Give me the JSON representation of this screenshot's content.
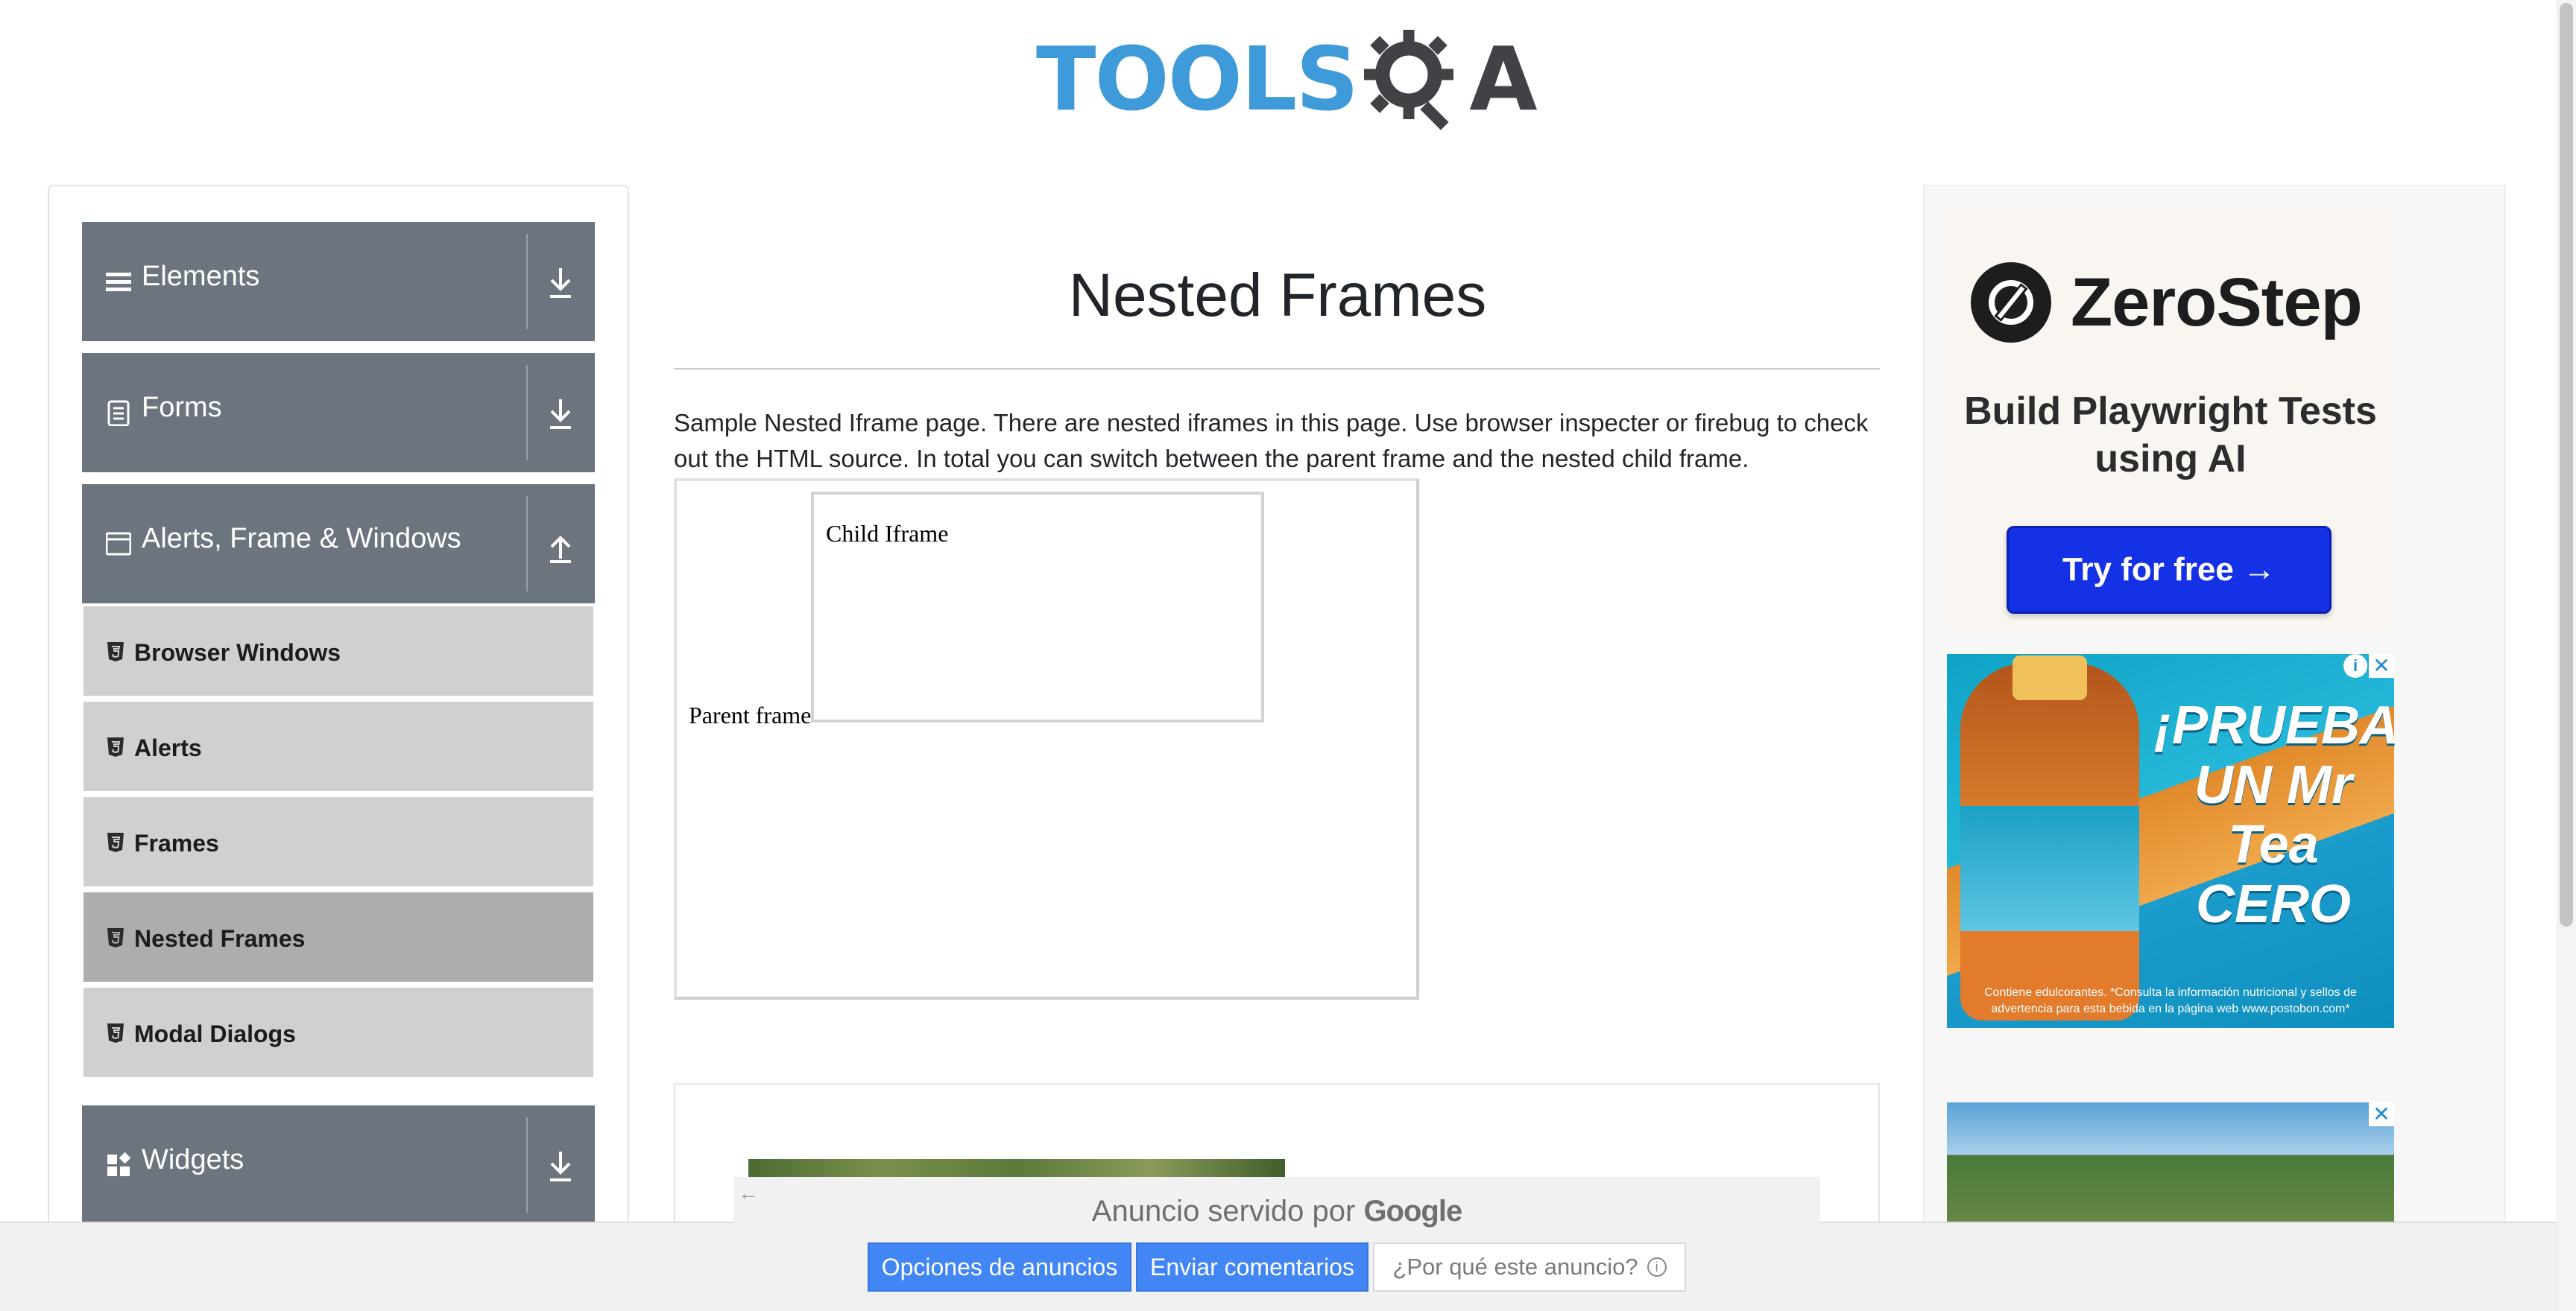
{
  "header": {
    "logo_text_left": "TOOLS",
    "logo_text_right": "A",
    "logo_icon": "gear-magnifier-icon"
  },
  "sidebar": {
    "groups": [
      {
        "label": "Elements",
        "icon": "hamburger-icon",
        "toggle_icon": "expand-down-icon"
      },
      {
        "label": "Forms",
        "icon": "document-icon",
        "toggle_icon": "expand-down-icon"
      },
      {
        "label": "Alerts, Frame & Windows",
        "icon": "window-icon",
        "toggle_icon": "collapse-up-icon"
      },
      {
        "label": "Widgets",
        "icon": "widgets-icon",
        "toggle_icon": "expand-down-icon"
      }
    ],
    "items": [
      {
        "label": "Browser Windows",
        "icon": "html5-icon",
        "active": false
      },
      {
        "label": "Alerts",
        "icon": "html5-icon",
        "active": false
      },
      {
        "label": "Frames",
        "icon": "html5-icon",
        "active": false
      },
      {
        "label": "Nested Frames",
        "icon": "html5-icon",
        "active": true
      },
      {
        "label": "Modal Dialogs",
        "icon": "html5-icon",
        "active": false
      }
    ]
  },
  "main": {
    "title": "Nested Frames",
    "description": "Sample Nested Iframe page. There are nested iframes in this page. Use browser inspecter or firebug to check out the HTML source. In total you can switch between the parent frame and the nested child frame.",
    "parent_frame_text": "Parent frame",
    "child_frame_text": "Child Iframe"
  },
  "ads": {
    "zerostep": {
      "brand": "ZeroStep",
      "headline": "Build Playwright Tests using AI",
      "cta": "Try for free →"
    },
    "tea": {
      "headline": "¡PRUEBA UN Mr Tea CERO",
      "footer": "Contiene edulcorantes. *Consulta la información nutricional y sellos de advertencia para esta bebida en la página web www.postobon.com*"
    }
  },
  "anchor_ad": {
    "served_by": "Anuncio servido por",
    "served_brand": "Google",
    "options_label": "Opciones de anuncios",
    "feedback_label": "Enviar comentarios",
    "why_label": "¿Por qué este anuncio?"
  },
  "colors": {
    "sidebar_group_bg": "#6c757d",
    "sidebar_item_bg": "#d0d0d0",
    "sidebar_item_active_bg": "#adadad",
    "logo_blue": "#3e9ad8",
    "logo_dark": "#404246",
    "cta_blue": "#1431e6",
    "google_blue": "#4285f4"
  }
}
